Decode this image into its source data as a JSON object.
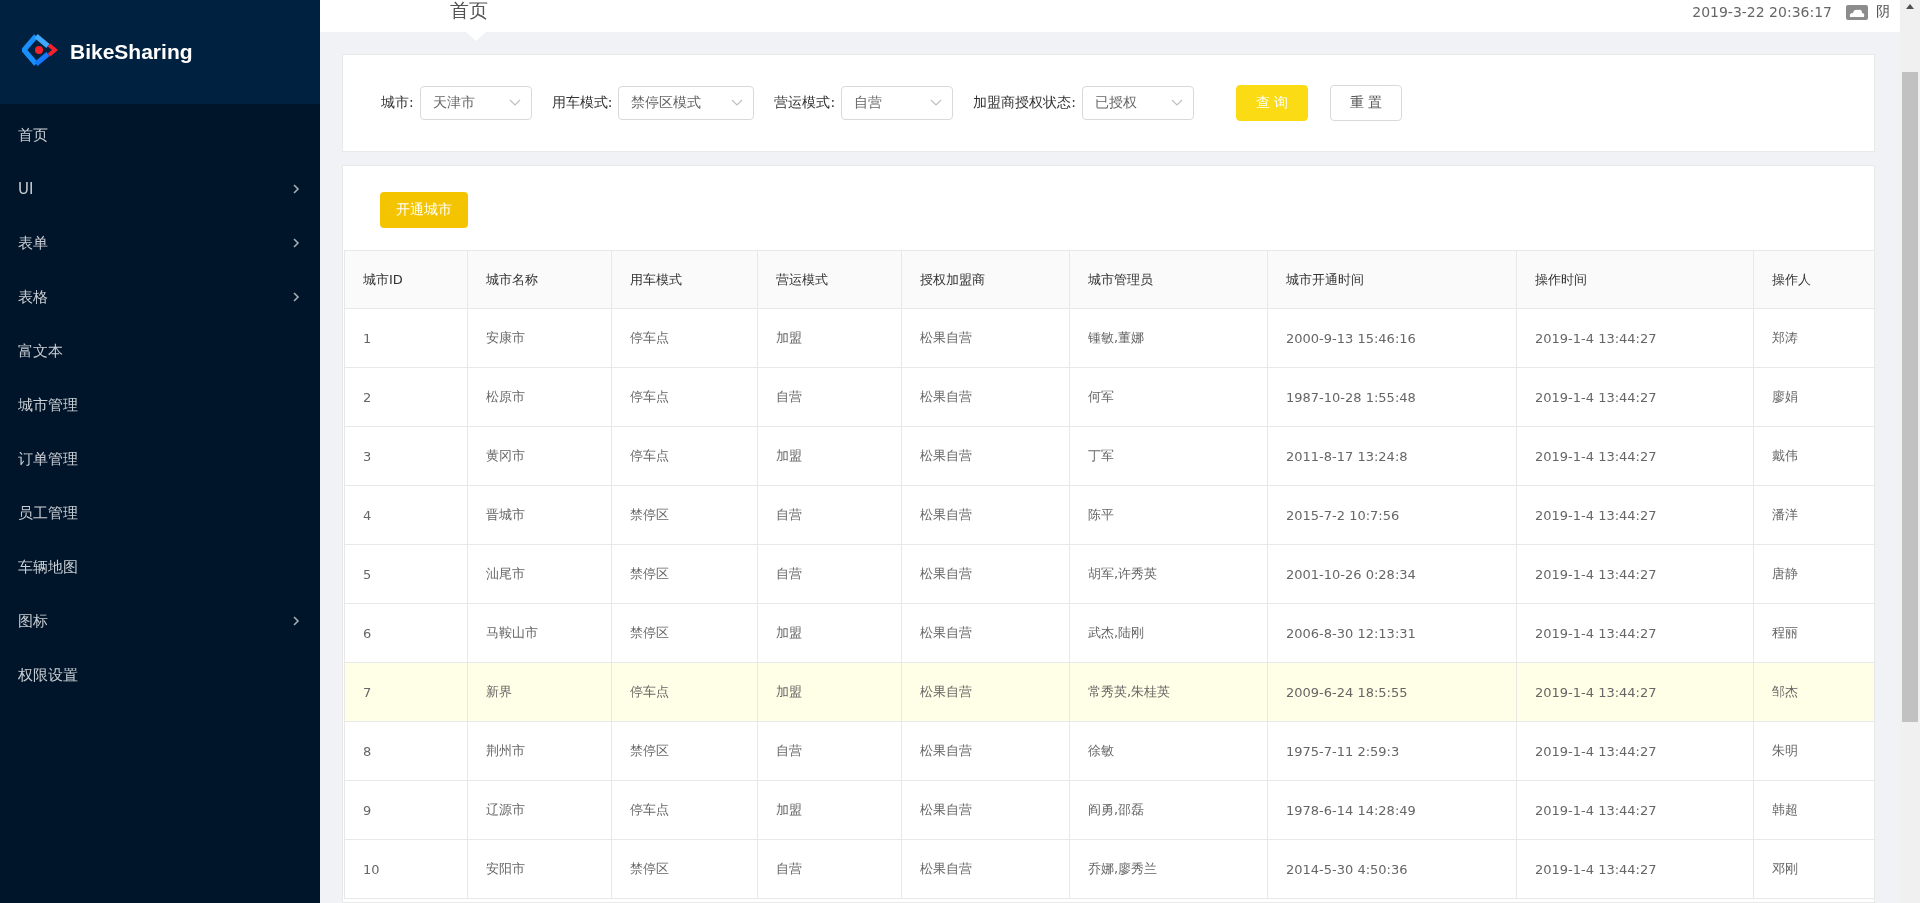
{
  "logo": {
    "name": "BikeSharing"
  },
  "sidebar": {
    "items": [
      {
        "label": "首页",
        "has_submenu": false
      },
      {
        "label": "UI",
        "has_submenu": true
      },
      {
        "label": "表单",
        "has_submenu": true
      },
      {
        "label": "表格",
        "has_submenu": true
      },
      {
        "label": "富文本",
        "has_submenu": false
      },
      {
        "label": "城市管理",
        "has_submenu": false
      },
      {
        "label": "订单管理",
        "has_submenu": false
      },
      {
        "label": "员工管理",
        "has_submenu": false
      },
      {
        "label": "车辆地图",
        "has_submenu": false
      },
      {
        "label": "图标",
        "has_submenu": true
      },
      {
        "label": "权限设置",
        "has_submenu": false
      }
    ]
  },
  "header": {
    "title": "首页",
    "datetime": "2019-3-22 20:36:17",
    "weather": "阴"
  },
  "filters": [
    {
      "label": "城市:",
      "value": "天津市"
    },
    {
      "label": "用车模式:",
      "value": "禁停区模式"
    },
    {
      "label": "营运模式:",
      "value": "自营"
    },
    {
      "label": "加盟商授权状态:",
      "value": "已授权"
    }
  ],
  "filter_buttons": [
    {
      "label": "查 询",
      "kind": "primary"
    },
    {
      "label": "重 置",
      "kind": "default"
    }
  ],
  "open_city_button": "开通城市",
  "table": {
    "columns": [
      "城市ID",
      "城市名称",
      "用车模式",
      "营运模式",
      "授权加盟商",
      "城市管理员",
      "城市开通时间",
      "操作时间",
      "操作人"
    ],
    "rows": [
      {
        "selected": false,
        "cells": [
          "1",
          "安康市",
          "停车点",
          "加盟",
          "松果自营",
          "锺敏,董娜",
          "2000-9-13 15:46:16",
          "2019-1-4 13:44:27",
          "郑涛"
        ]
      },
      {
        "selected": false,
        "cells": [
          "2",
          "松原市",
          "停车点",
          "自营",
          "松果自营",
          "何军",
          "1987-10-28 1:55:48",
          "2019-1-4 13:44:27",
          "廖娟"
        ]
      },
      {
        "selected": false,
        "cells": [
          "3",
          "黄冈市",
          "停车点",
          "加盟",
          "松果自营",
          "丁军",
          "2011-8-17 13:24:8",
          "2019-1-4 13:44:27",
          "戴伟"
        ]
      },
      {
        "selected": false,
        "cells": [
          "4",
          "晋城市",
          "禁停区",
          "自营",
          "松果自营",
          "陈平",
          "2015-7-2 10:7:56",
          "2019-1-4 13:44:27",
          "潘洋"
        ]
      },
      {
        "selected": false,
        "cells": [
          "5",
          "汕尾市",
          "禁停区",
          "自营",
          "松果自营",
          "胡军,许秀英",
          "2001-10-26 0:28:34",
          "2019-1-4 13:44:27",
          "唐静"
        ]
      },
      {
        "selected": false,
        "cells": [
          "6",
          "马鞍山市",
          "禁停区",
          "加盟",
          "松果自营",
          "武杰,陆刚",
          "2006-8-30 12:13:31",
          "2019-1-4 13:44:27",
          "程丽"
        ]
      },
      {
        "selected": true,
        "cells": [
          "7",
          "新界",
          "停车点",
          "加盟",
          "松果自营",
          "常秀英,朱桂英",
          "2009-6-24 18:5:55",
          "2019-1-4 13:44:27",
          "邹杰"
        ]
      },
      {
        "selected": false,
        "cells": [
          "8",
          "荆州市",
          "禁停区",
          "自营",
          "松果自营",
          "徐敏",
          "1975-7-11 2:59:3",
          "2019-1-4 13:44:27",
          "朱明"
        ]
      },
      {
        "selected": false,
        "cells": [
          "9",
          "辽源市",
          "停车点",
          "加盟",
          "松果自营",
          "阎勇,邵磊",
          "1978-6-14 14:28:49",
          "2019-1-4 13:44:27",
          "韩超"
        ]
      },
      {
        "selected": false,
        "cells": [
          "10",
          "安阳市",
          "禁停区",
          "自营",
          "松果自营",
          "乔娜,廖秀兰",
          "2014-5-30 4:50:36",
          "2019-1-4 13:44:27",
          "邓刚"
        ]
      }
    ]
  }
}
